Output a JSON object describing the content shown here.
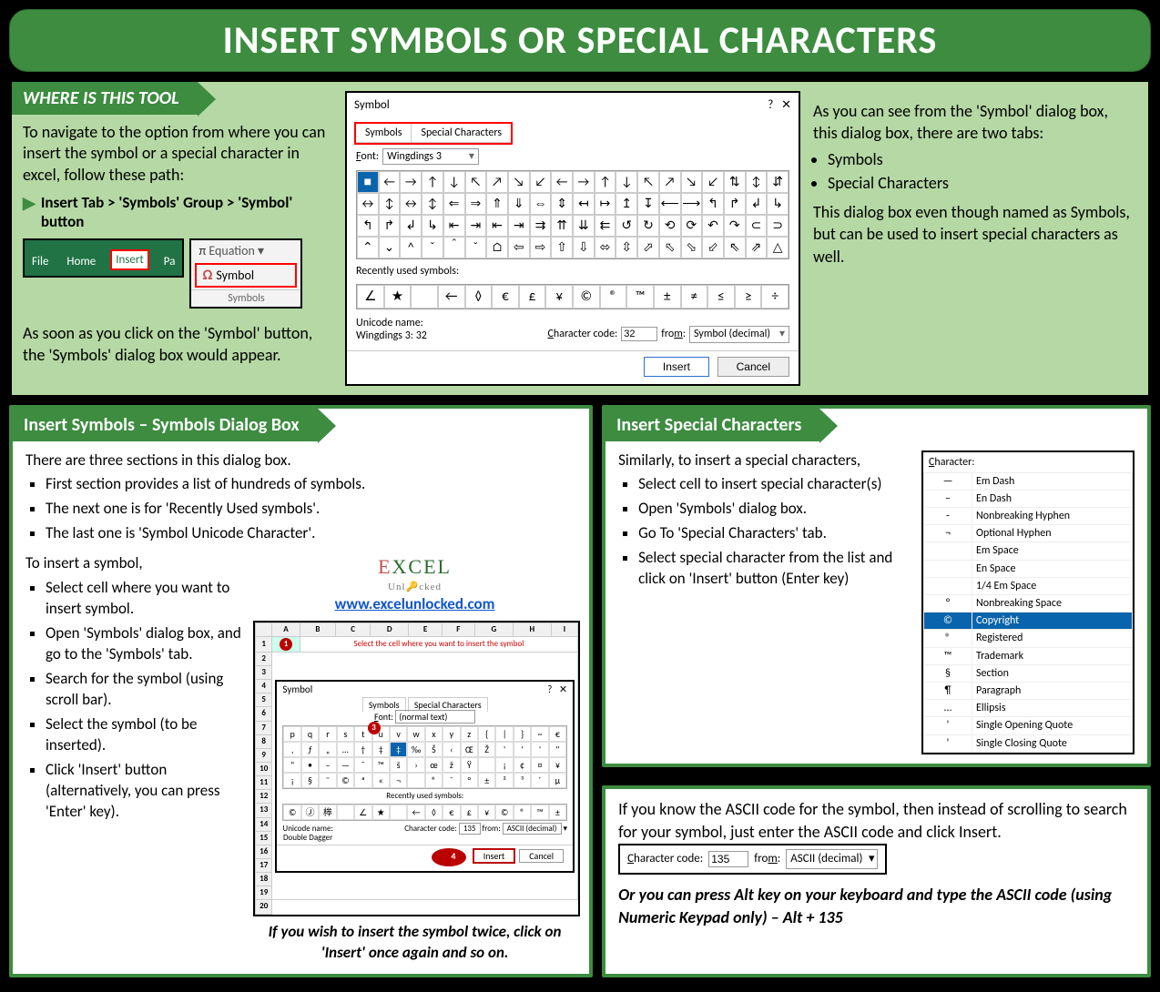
{
  "title": "INSERT SYMBOLS OR SPECIAL CHARACTERS",
  "sec1": {
    "header": "WHERE IS THIS TOOL",
    "intro": "To navigate to the option from where you can insert the symbol or a special character in excel, follow these path:",
    "path": "Insert Tab > 'Symbols' Group > 'Symbol' button",
    "ribbon": {
      "tabs": [
        "File",
        "Home",
        "Insert",
        "Pa"
      ],
      "equation": "Equation",
      "symbol": "Symbol",
      "group": "Symbols"
    },
    "after": "As soon as you click on the 'Symbol' button, the 'Symbols' dialog box would appear."
  },
  "dialog1": {
    "title": "Symbol",
    "tabs": [
      "Symbols",
      "Special Characters"
    ],
    "font_label": "Font:",
    "font": "Wingdings 3",
    "grid_row1": [
      "■",
      "←",
      "→",
      "↑",
      "↓",
      "↖",
      "↗",
      "↘",
      "↙",
      "←",
      "→",
      "↑",
      "↓",
      "↖",
      "↗",
      "↘",
      "↙",
      "⇅",
      "↕",
      "⇵"
    ],
    "grid_row2": [
      "↔",
      "↕",
      "↔",
      "↕",
      "⇐",
      "⇒",
      "⇑",
      "⇓",
      "⇔",
      "⇕",
      "↤",
      "↦",
      "↥",
      "↧",
      "⟵",
      "⟶",
      "↰",
      "↱",
      "↲",
      "↳"
    ],
    "grid_row3": [
      "↰",
      "↱",
      "↲",
      "↳",
      "⇤",
      "⇥",
      "⇤",
      "⇥",
      "⇉",
      "⇈",
      "⇊",
      "⇇",
      "↺",
      "↻",
      "⟲",
      "⟳",
      "↶",
      "↷",
      "⊂",
      "⊃"
    ],
    "grid_row4": [
      "⌃",
      "⌄",
      "^",
      "ˇ",
      "＾",
      "ˬ",
      "⌂",
      "⇦",
      "⇨",
      "⇧",
      "⇩",
      "⬄",
      "⇳",
      "⬀",
      "⬁",
      "⬂",
      "⬃",
      "⇖",
      "⇗",
      "△"
    ],
    "recent_label": "Recently used symbols:",
    "recent": [
      "∠",
      "★",
      "",
      "←",
      "◊",
      "€",
      "£",
      "¥",
      "©",
      "®",
      "™",
      "±",
      "≠",
      "≤",
      "≥",
      "÷",
      "×"
    ],
    "unicode_label": "Unicode name:",
    "unicode_name": "Wingdings 3: 32",
    "char_code_label": "Character code:",
    "char_code": "32",
    "from_label": "from:",
    "from_value": "Symbol (decimal)",
    "insert": "Insert",
    "cancel": "Cancel"
  },
  "right1": {
    "p1": "As you can see from the 'Symbol' dialog box, this dialog box, there are two tabs:",
    "bul": [
      "Symbols",
      "Special Characters"
    ],
    "p2": "This dialog box even though named as Symbols, but can be used to insert special characters as well."
  },
  "sec2": {
    "header": "Insert Symbols – Symbols Dialog Box",
    "p1": "There are three sections in this dialog box.",
    "bul1": [
      "First section provides a list of hundreds of symbols.",
      "The next one is for 'Recently Used symbols'.",
      "The last one is 'Symbol Unicode Character'."
    ],
    "p2": "To insert a symbol,",
    "bul2": [
      "Select cell where you want to insert symbol.",
      "Open 'Symbols' dialog box, and go to the 'Symbols' tab.",
      "Search for the symbol (using scroll bar).",
      "Select the symbol (to be inserted).",
      "Click 'Insert' button (alternatively, you can press 'Enter' key)."
    ],
    "logo_link": "www.excelunlocked.com",
    "tip": "If you wish to insert the symbol twice, click on 'Insert' once again and so on."
  },
  "mini": {
    "sheet_note": "Select the cell where you want to insert the symbol",
    "cols": [
      "A",
      "B",
      "C",
      "D",
      "E",
      "F",
      "G",
      "H",
      "I"
    ],
    "title": "Symbol",
    "tabs": [
      "Symbols",
      "Special Characters"
    ],
    "font_label": "Font:",
    "font": "(normal text)",
    "r1": [
      "p",
      "q",
      "r",
      "s",
      "t",
      "u",
      "v",
      "w",
      "x",
      "y",
      "z",
      "{",
      "|",
      "}",
      "~",
      "€"
    ],
    "r2": [
      "‚",
      "ƒ",
      "„",
      "…",
      "†",
      "‡",
      "ˆ",
      "‰",
      "Š",
      "‹",
      "Œ",
      "Ž",
      "'",
      "'",
      "'",
      "\""
    ],
    "r3": [
      "\"",
      "•",
      "–",
      "—",
      "˜",
      "™",
      "š",
      "›",
      "œ",
      "ž",
      "Ÿ",
      " ",
      "¡",
      "¢",
      "¤",
      "¥"
    ],
    "r4": [
      "¡",
      "§",
      "¨",
      "©",
      "ª",
      "«",
      "¬",
      "­",
      "®",
      "¯",
      "°",
      "±",
      "²",
      "³",
      "´",
      "µ"
    ],
    "recent_label": "Recently used symbols:",
    "recent": [
      "©",
      "Ⓙ",
      "桳",
      "",
      "∠",
      "★",
      "",
      "←",
      "◊",
      "€",
      "£",
      "¥",
      "©",
      "®",
      "™",
      "±"
    ],
    "unicode_label": "Unicode name:",
    "uname": "Double Dagger",
    "char_code_label": "Character code:",
    "code": "135",
    "from_label": "from:",
    "from": "ASCII (decimal)",
    "insert": "Insert",
    "cancel": "Cancel"
  },
  "sec3": {
    "header": "Insert Special Characters",
    "p1": "Similarly, to insert a special characters,",
    "bul": [
      "Select cell to insert special character(s)",
      "Open 'Symbols' dialog box.",
      "Go To 'Special Characters' tab.",
      "Select special character from the list and click on 'Insert' button (Enter key)"
    ],
    "list_header": "Character:",
    "list": [
      [
        "—",
        "Em Dash"
      ],
      [
        "–",
        "En Dash"
      ],
      [
        "-",
        "Nonbreaking Hyphen"
      ],
      [
        "¬",
        "Optional Hyphen"
      ],
      [
        "",
        "Em Space"
      ],
      [
        "",
        "En Space"
      ],
      [
        "",
        "1/4 Em Space"
      ],
      [
        "°",
        "Nonbreaking Space"
      ],
      [
        "©",
        "Copyright"
      ],
      [
        "®",
        "Registered"
      ],
      [
        "™",
        "Trademark"
      ],
      [
        "§",
        "Section"
      ],
      [
        "¶",
        "Paragraph"
      ],
      [
        "…",
        "Ellipsis"
      ],
      [
        "'",
        "Single Opening Quote"
      ],
      [
        "'",
        "Single Closing Quote"
      ]
    ]
  },
  "sec4": {
    "p1": "If you know the ASCII code for the symbol, then instead of scrolling to search for your symbol, just enter the ASCII code and click Insert.",
    "code_label": "Character code:",
    "code": "135",
    "from_label": "from:",
    "from": "ASCII (decimal)",
    "p2": "Or you can press Alt key on your keyboard and type the ASCII code (using Numeric Keypad only) – Alt + 135"
  }
}
